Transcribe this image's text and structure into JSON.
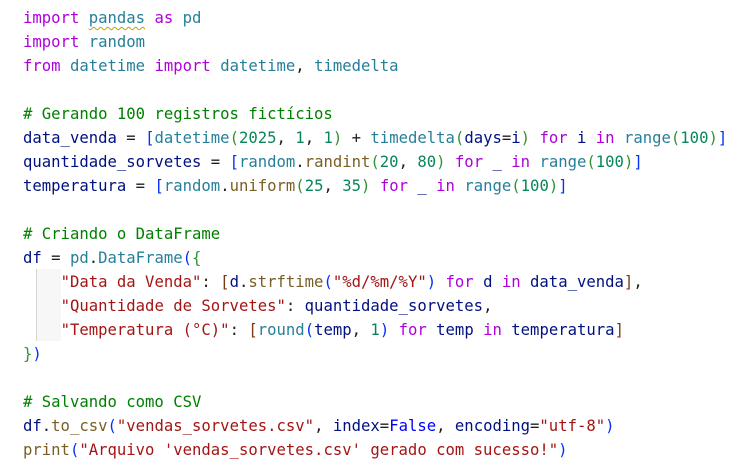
{
  "editor": {
    "language": "python",
    "lines": [
      [
        [
          "cf",
          "import"
        ],
        [
          "op",
          " "
        ],
        [
          "ty sq",
          "pandas"
        ],
        [
          "op",
          " "
        ],
        [
          "cf",
          "as"
        ],
        [
          "op",
          " "
        ],
        [
          "ty",
          "pd"
        ]
      ],
      [
        [
          "cf",
          "import"
        ],
        [
          "op",
          " "
        ],
        [
          "ty",
          "random"
        ]
      ],
      [
        [
          "cf",
          "from"
        ],
        [
          "op",
          " "
        ],
        [
          "ty",
          "datetime"
        ],
        [
          "op",
          " "
        ],
        [
          "cf",
          "import"
        ],
        [
          "op",
          " "
        ],
        [
          "ty",
          "datetime"
        ],
        [
          "op",
          ", "
        ],
        [
          "ty",
          "timedelta"
        ]
      ],
      [],
      [
        [
          "cm",
          "# Gerando 100 registros fictícios"
        ]
      ],
      [
        [
          "vr",
          "data_venda"
        ],
        [
          "op",
          " = "
        ],
        [
          "b1",
          "["
        ],
        [
          "ty",
          "datetime"
        ],
        [
          "b2",
          "("
        ],
        [
          "nm",
          "2025"
        ],
        [
          "op",
          ", "
        ],
        [
          "nm",
          "1"
        ],
        [
          "op",
          ", "
        ],
        [
          "nm",
          "1"
        ],
        [
          "b2",
          ")"
        ],
        [
          "op",
          " + "
        ],
        [
          "ty",
          "timedelta"
        ],
        [
          "b2",
          "("
        ],
        [
          "vr",
          "days"
        ],
        [
          "op",
          "="
        ],
        [
          "vr",
          "i"
        ],
        [
          "b2",
          ")"
        ],
        [
          "op",
          " "
        ],
        [
          "cf",
          "for"
        ],
        [
          "op",
          " "
        ],
        [
          "vr",
          "i"
        ],
        [
          "op",
          " "
        ],
        [
          "cf",
          "in"
        ],
        [
          "op",
          " "
        ],
        [
          "ty",
          "range"
        ],
        [
          "b2",
          "("
        ],
        [
          "nm",
          "100"
        ],
        [
          "b2",
          ")"
        ],
        [
          "b1",
          "]"
        ]
      ],
      [
        [
          "vr",
          "quantidade_sorvetes"
        ],
        [
          "op",
          " = "
        ],
        [
          "b1",
          "["
        ],
        [
          "ty",
          "random"
        ],
        [
          "op",
          "."
        ],
        [
          "fn",
          "randint"
        ],
        [
          "b2",
          "("
        ],
        [
          "nm",
          "20"
        ],
        [
          "op",
          ", "
        ],
        [
          "nm",
          "80"
        ],
        [
          "b2",
          ")"
        ],
        [
          "op",
          " "
        ],
        [
          "cf",
          "for"
        ],
        [
          "op",
          " "
        ],
        [
          "vr",
          "_"
        ],
        [
          "op",
          " "
        ],
        [
          "cf",
          "in"
        ],
        [
          "op",
          " "
        ],
        [
          "ty",
          "range"
        ],
        [
          "b2",
          "("
        ],
        [
          "nm",
          "100"
        ],
        [
          "b2",
          ")"
        ],
        [
          "b1",
          "]"
        ]
      ],
      [
        [
          "vr",
          "temperatura"
        ],
        [
          "op",
          " = "
        ],
        [
          "b1",
          "["
        ],
        [
          "ty",
          "random"
        ],
        [
          "op",
          "."
        ],
        [
          "fn",
          "uniform"
        ],
        [
          "b2",
          "("
        ],
        [
          "nm",
          "25"
        ],
        [
          "op",
          ", "
        ],
        [
          "nm",
          "35"
        ],
        [
          "b2",
          ")"
        ],
        [
          "op",
          " "
        ],
        [
          "cf",
          "for"
        ],
        [
          "op",
          " "
        ],
        [
          "vr",
          "_"
        ],
        [
          "op",
          " "
        ],
        [
          "cf",
          "in"
        ],
        [
          "op",
          " "
        ],
        [
          "ty",
          "range"
        ],
        [
          "b2",
          "("
        ],
        [
          "nm",
          "100"
        ],
        [
          "b2",
          ")"
        ],
        [
          "b1",
          "]"
        ]
      ],
      [],
      [
        [
          "cm",
          "# Criando o DataFrame"
        ]
      ],
      [
        [
          "vr",
          "df"
        ],
        [
          "op",
          " = "
        ],
        [
          "ty",
          "pd"
        ],
        [
          "op",
          "."
        ],
        [
          "ty",
          "DataFrame"
        ],
        [
          "b1",
          "("
        ],
        [
          "b2",
          "{"
        ]
      ],
      [
        [
          "op",
          "    "
        ],
        [
          "st",
          "\"Data da Venda\""
        ],
        [
          "op",
          ": "
        ],
        [
          "b3",
          "["
        ],
        [
          "vr",
          "d"
        ],
        [
          "op",
          "."
        ],
        [
          "fn",
          "strftime"
        ],
        [
          "b1",
          "("
        ],
        [
          "st",
          "\"%d/%m/%Y\""
        ],
        [
          "b1",
          ")"
        ],
        [
          "op",
          " "
        ],
        [
          "cf",
          "for"
        ],
        [
          "op",
          " "
        ],
        [
          "vr",
          "d"
        ],
        [
          "op",
          " "
        ],
        [
          "cf",
          "in"
        ],
        [
          "op",
          " "
        ],
        [
          "vr",
          "data_venda"
        ],
        [
          "b3",
          "]"
        ],
        [
          "op",
          ","
        ]
      ],
      [
        [
          "op",
          "    "
        ],
        [
          "st",
          "\"Quantidade de Sorvetes\""
        ],
        [
          "op",
          ": "
        ],
        [
          "vr",
          "quantidade_sorvetes"
        ],
        [
          "op",
          ","
        ]
      ],
      [
        [
          "op",
          "    "
        ],
        [
          "st",
          "\"Temperatura (°C)\""
        ],
        [
          "op",
          ": "
        ],
        [
          "b3",
          "["
        ],
        [
          "ty",
          "round"
        ],
        [
          "b1",
          "("
        ],
        [
          "vr",
          "temp"
        ],
        [
          "op",
          ", "
        ],
        [
          "nm",
          "1"
        ],
        [
          "b1",
          ")"
        ],
        [
          "op",
          " "
        ],
        [
          "cf",
          "for"
        ],
        [
          "op",
          " "
        ],
        [
          "vr",
          "temp"
        ],
        [
          "op",
          " "
        ],
        [
          "cf",
          "in"
        ],
        [
          "op",
          " "
        ],
        [
          "vr",
          "temperatura"
        ],
        [
          "b3",
          "]"
        ]
      ],
      [
        [
          "b2",
          "}"
        ],
        [
          "b1",
          ")"
        ]
      ],
      [],
      [
        [
          "cm",
          "# Salvando como CSV"
        ]
      ],
      [
        [
          "vr",
          "df"
        ],
        [
          "op",
          "."
        ],
        [
          "fn",
          "to_csv"
        ],
        [
          "b1",
          "("
        ],
        [
          "st",
          "\"vendas_sorvetes.csv\""
        ],
        [
          "op",
          ", "
        ],
        [
          "vr",
          "index"
        ],
        [
          "op",
          "="
        ],
        [
          "kw",
          "False"
        ],
        [
          "op",
          ", "
        ],
        [
          "vr",
          "encoding"
        ],
        [
          "op",
          "="
        ],
        [
          "st",
          "\"utf-8\""
        ],
        [
          "b1",
          ")"
        ]
      ],
      [
        [
          "fn",
          "print"
        ],
        [
          "b1",
          "("
        ],
        [
          "st",
          "\"Arquivo 'vendas_sorvetes.csv' gerado com sucesso!\""
        ],
        [
          "b1",
          ")"
        ]
      ]
    ]
  }
}
